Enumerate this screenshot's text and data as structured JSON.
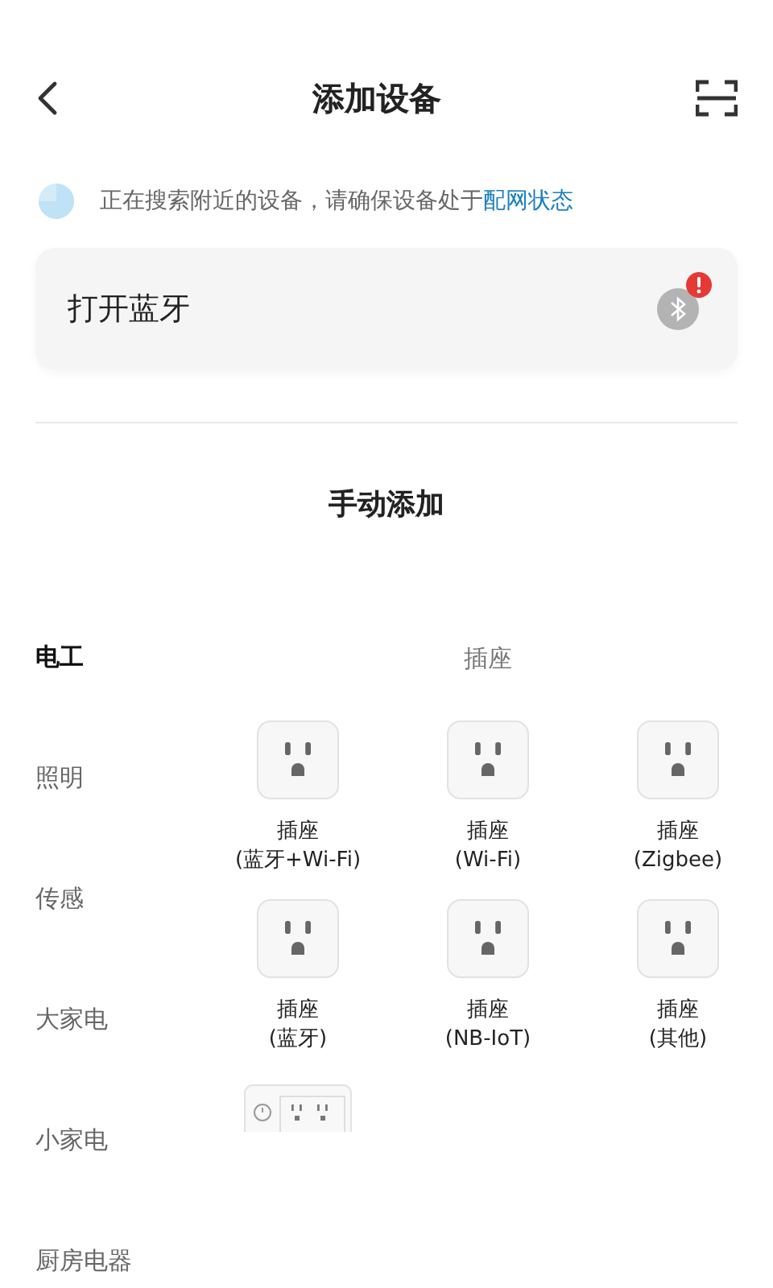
{
  "header": {
    "title": "添加设备"
  },
  "hint": {
    "text": "正在搜索附近的设备，请确保设备处于",
    "link": "配网状态"
  },
  "bluetooth_card": {
    "label": "打开蓝牙",
    "alert": true
  },
  "section_title": "手动添加",
  "categories": [
    {
      "label": "电工",
      "selected": true
    },
    {
      "label": "照明",
      "selected": false
    },
    {
      "label": "传感",
      "selected": false
    },
    {
      "label": "大家电",
      "selected": false
    },
    {
      "label": "小家电",
      "selected": false
    },
    {
      "label": "厨房电器",
      "selected": false
    }
  ],
  "group_title": "插座",
  "devices": [
    {
      "kind": "socket",
      "name": "插座",
      "detail": "(蓝牙+Wi-Fi)"
    },
    {
      "kind": "socket",
      "name": "插座",
      "detail": "(Wi-Fi)"
    },
    {
      "kind": "socket",
      "name": "插座",
      "detail": "(Zigbee)"
    },
    {
      "kind": "socket",
      "name": "插座",
      "detail": "(蓝牙)"
    },
    {
      "kind": "socket",
      "name": "插座",
      "detail": "(NB-IoT)"
    },
    {
      "kind": "socket",
      "name": "插座",
      "detail": "(其他)"
    },
    {
      "kind": "strip"
    }
  ]
}
